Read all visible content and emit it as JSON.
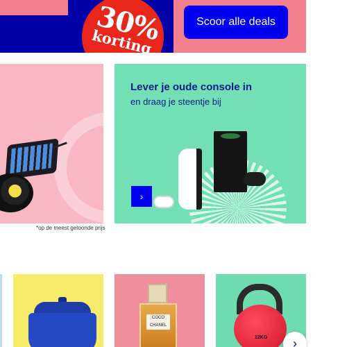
{
  "promo": {
    "discount": "30%",
    "discount_label": "korting",
    "cta_label": "Scoor alle deals",
    "colors": {
      "banner_bg": "#f2808f",
      "blue": "#0000a8",
      "badge": "#e8261c",
      "cta": "#0000ef"
    }
  },
  "deal_card": {
    "footnote": "*op de meest getoonde prijs"
  },
  "console_card": {
    "title": "Lever je oude console in",
    "subtitle": "en draag je steentje bij",
    "arrow_icon": "chevron-right-icon",
    "arrow_glyph": "›",
    "colors": {
      "bg": "#72e0b4",
      "text": "#0b1b8a"
    }
  },
  "products": {
    "perfume_label_line1": "COCO",
    "perfume_label_line2": "CHANEL",
    "kettlebell_label": "12KG",
    "next_icon": "chevron-right-icon",
    "next_glyph": "›"
  }
}
